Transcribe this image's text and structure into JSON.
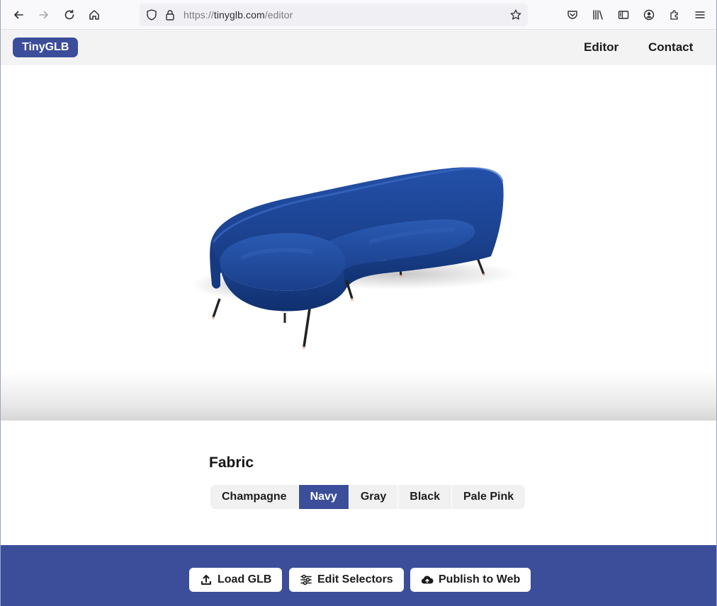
{
  "browser": {
    "url_scheme": "https://",
    "url_host": "tinyglb.com",
    "url_path": "/editor"
  },
  "header": {
    "brand": "TinyGLB",
    "nav": [
      {
        "label": "Editor"
      },
      {
        "label": "Contact"
      }
    ]
  },
  "viewer": {
    "model": "curved sofa",
    "fabric_color": "#1b3f8c"
  },
  "selector": {
    "title": "Fabric",
    "options": [
      {
        "label": "Champagne"
      },
      {
        "label": "Navy"
      },
      {
        "label": "Gray"
      },
      {
        "label": "Black"
      },
      {
        "label": "Pale Pink"
      }
    ],
    "selected": "Navy"
  },
  "actions": [
    {
      "label": "Load GLB",
      "icon": "upload-icon"
    },
    {
      "label": "Edit Selectors",
      "icon": "sliders-icon"
    },
    {
      "label": "Publish to Web",
      "icon": "cloud-upload-icon"
    }
  ],
  "colors": {
    "accent": "#3c4e9a",
    "header_bg": "#f3f3f3",
    "browser_bg": "#f9f9fb"
  }
}
